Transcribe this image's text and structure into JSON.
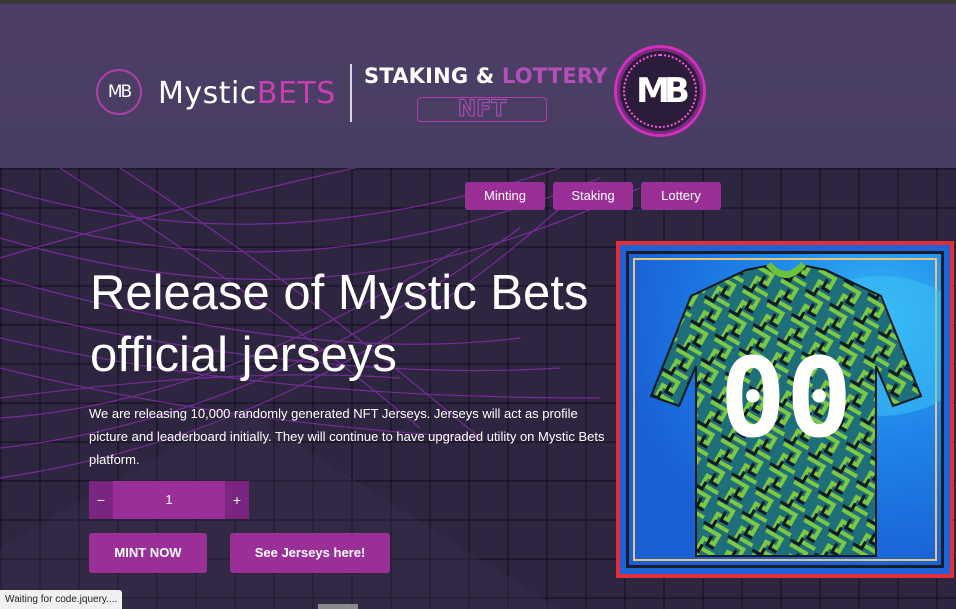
{
  "header": {
    "brand_white": "Mystic",
    "brand_pink": "BETS",
    "logo_small_text": "MB",
    "staking_white": "STAKING & ",
    "staking_pink": "LOTTERY",
    "nft_label": "NFT",
    "logo_big_text": "MB"
  },
  "nav": {
    "items": [
      {
        "label": "Minting"
      },
      {
        "label": "Staking"
      },
      {
        "label": "Lottery"
      }
    ]
  },
  "hero": {
    "headline": "Release of Mystic Bets official jerseys",
    "description": "We are releasing 10,000 randomly generated NFT Jerseys. Jerseys will act as profile picture and leaderboard initially. They will continue to have upgraded utility on Mystic Bets platform.",
    "quantity": {
      "minus": "−",
      "value": "1",
      "plus": "+"
    },
    "mint_label": "MINT NOW",
    "see_jerseys_label": "See Jerseys here!",
    "jersey_number": "00"
  },
  "status_bar": {
    "text": "Waiting for code.jquery...."
  },
  "colors": {
    "accent": "#9a2f98",
    "header_bg": "#4c3e66",
    "hero_bg": "#2e2640",
    "frame_border": "#e02f3a"
  }
}
